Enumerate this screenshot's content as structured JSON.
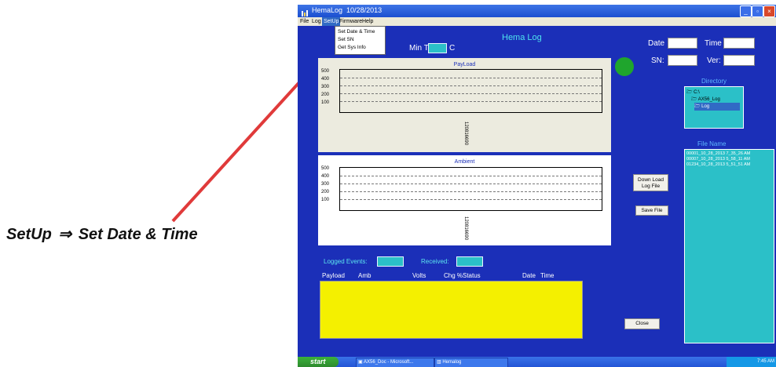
{
  "caption": {
    "menu": "SetUp",
    "arrow": "⇒",
    "item": "Set Date & Time"
  },
  "window": {
    "title": "HemaLog",
    "title_date": "10/28/2013",
    "menubar": [
      "File",
      "Log",
      "SetUp",
      "Firmware",
      "Help"
    ],
    "dropdown": [
      "Set Date & Time",
      "Set SN",
      "Get Sys Info"
    ],
    "header": {
      "app_name": "Hema Log",
      "min_t_label": "Min T",
      "min_t_unit": "C"
    },
    "info": {
      "date_label": "Date",
      "time_label": "Time",
      "sn_label": "SN:",
      "ver_label": "Ver:"
    },
    "payload_chart": {
      "title": "PayLoad",
      "ticks": [
        "500",
        "400",
        "300",
        "200",
        "100"
      ],
      "axis_text": "120816690"
    },
    "ambient_chart": {
      "title": "Ambient",
      "ticks": [
        "500",
        "400",
        "300",
        "200",
        "100"
      ],
      "axis_text": "120816690"
    },
    "buttons": {
      "download": "Down Load\nLog File",
      "save": "Save File",
      "close": "Close"
    },
    "directory": {
      "label": "Directory",
      "items": [
        "C:\\",
        "AX56_Log",
        "Log"
      ]
    },
    "file_name": {
      "label": "File Name",
      "files": [
        "00001_10_28_2013 7_35_26 AM",
        "00007_10_28_2013 5_58_11 AM",
        "01234_10_28_2013 5_51_51 AM"
      ]
    },
    "events": {
      "logged_label": "Logged Events:",
      "received_label": "Received:"
    },
    "table_headers": [
      "Payload",
      "Amb",
      "Volts",
      "Chg %",
      "Status",
      "Date",
      "Time"
    ],
    "taskbar": {
      "start": "start",
      "items": [
        "AX56_Doc - Microsoft...",
        "Hemalog"
      ],
      "clock": "7:45 AM"
    }
  },
  "colors": {
    "window_bg": "#1b2fb8",
    "cyan": "#2bc0c8",
    "yellow": "#f4f000",
    "arrow": "#e03a3a",
    "green": "#1fa52d"
  }
}
